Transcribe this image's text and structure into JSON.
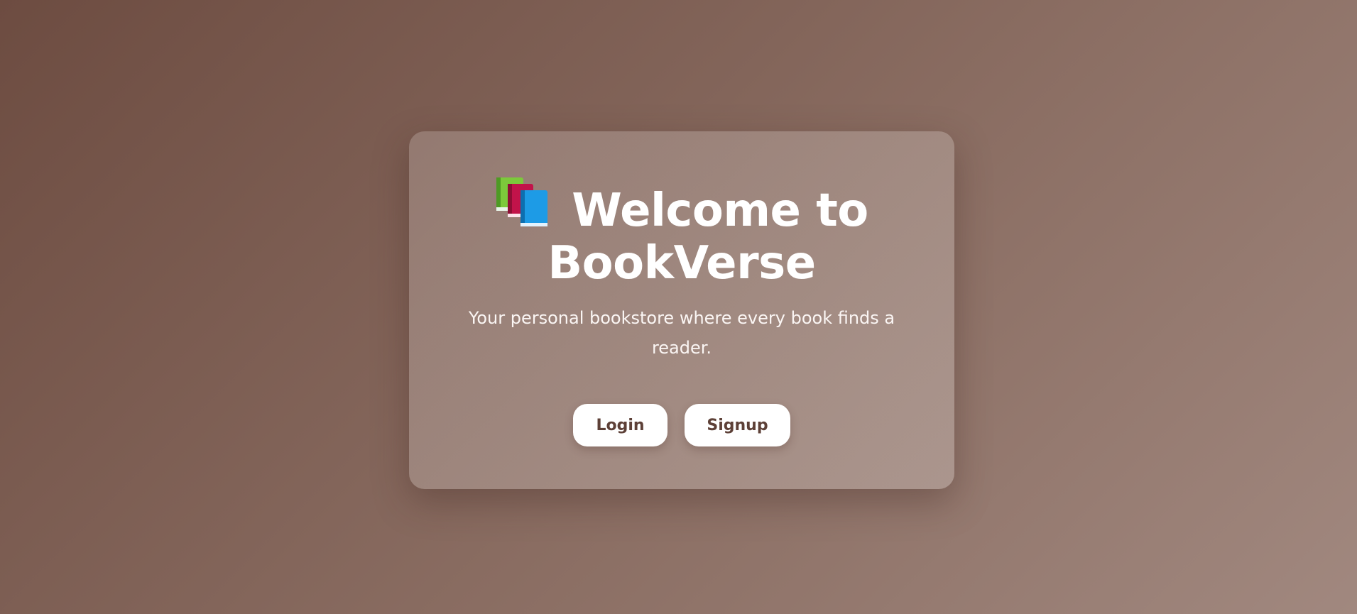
{
  "page": {
    "background_gradient": [
      "#6d4c41",
      "#a1887f"
    ]
  },
  "hero": {
    "icon": "books-icon",
    "title_line_1": "Welcome to",
    "title_line_2": "BookVerse",
    "subtitle": "Your personal bookstore where every book finds a reader."
  },
  "actions": {
    "login_label": "Login",
    "signup_label": "Signup"
  },
  "colors": {
    "button_text": "#5d4037",
    "button_bg": "#ffffff",
    "title_text": "#ffffff"
  }
}
